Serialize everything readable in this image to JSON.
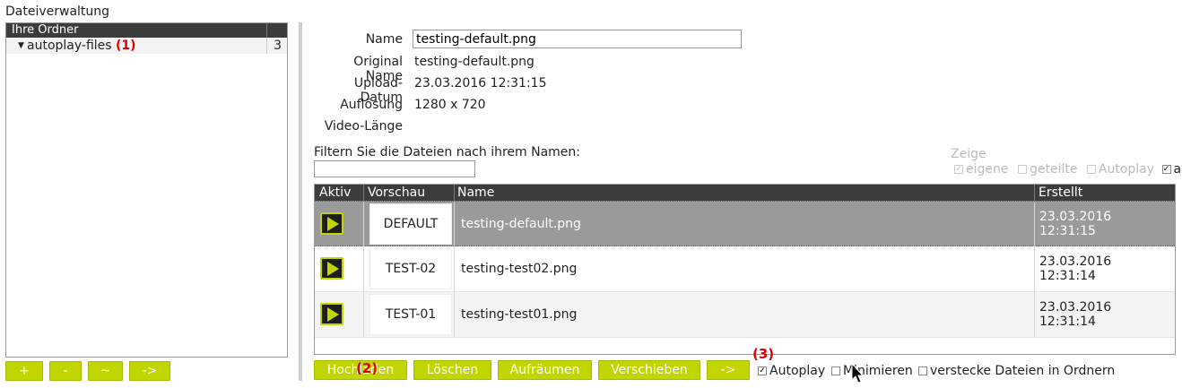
{
  "app": {
    "title": "Dateiverwaltung"
  },
  "folders": {
    "header": "Ihre Ordner",
    "items": [
      {
        "name": "autoplay-files",
        "count": "3",
        "badge": "(1)"
      }
    ],
    "buttons": {
      "add": "+",
      "remove": "-",
      "rename": "~",
      "move": "->"
    }
  },
  "details": {
    "name_label": "Name",
    "name_value": "testing-default.png",
    "original_label": "Original Name",
    "original_value": "testing-default.png",
    "upload_label": "Upload-Datum",
    "upload_value": "23.03.2016 12:31:15",
    "resolution_label": "Auflösung",
    "resolution_value": "1280 x 720",
    "video_label": "Video-Länge",
    "video_value": ""
  },
  "filter": {
    "label": "Filtern Sie die Dateien nach ihrem Namen:",
    "value": ""
  },
  "show": {
    "title": "Zeige",
    "own": "eigene",
    "shared": "geteilte",
    "autoplay": "Autoplay",
    "all": "alle"
  },
  "table": {
    "columns": {
      "active": "Aktiv",
      "preview": "Vorschau",
      "name": "Name",
      "created": "Erstellt"
    },
    "rows": [
      {
        "thumb": "DEFAULT",
        "name": "testing-default.png",
        "date": "23.03.2016",
        "time": "12:31:15"
      },
      {
        "thumb": "TEST-02",
        "name": "testing-test02.png",
        "date": "23.03.2016",
        "time": "12:31:14"
      },
      {
        "thumb": "TEST-01",
        "name": "testing-test01.png",
        "date": "23.03.2016",
        "time": "12:31:14"
      }
    ]
  },
  "actions": {
    "upload": "Hochladen",
    "delete": "Löschen",
    "cleanup": "Aufräumen",
    "move": "Verschieben",
    "arrow": "->",
    "badge_upload": "(2)",
    "badge_autoplay": "(3)"
  },
  "options": {
    "autoplay": "Autoplay",
    "minimize": "Minimieren",
    "hide": "verstecke Dateien in Ordnern"
  },
  "colors": {
    "accent": "#c1d600",
    "header": "#3c3c3c",
    "selected_row": "#9a9a9a",
    "badge": "#e00000"
  }
}
